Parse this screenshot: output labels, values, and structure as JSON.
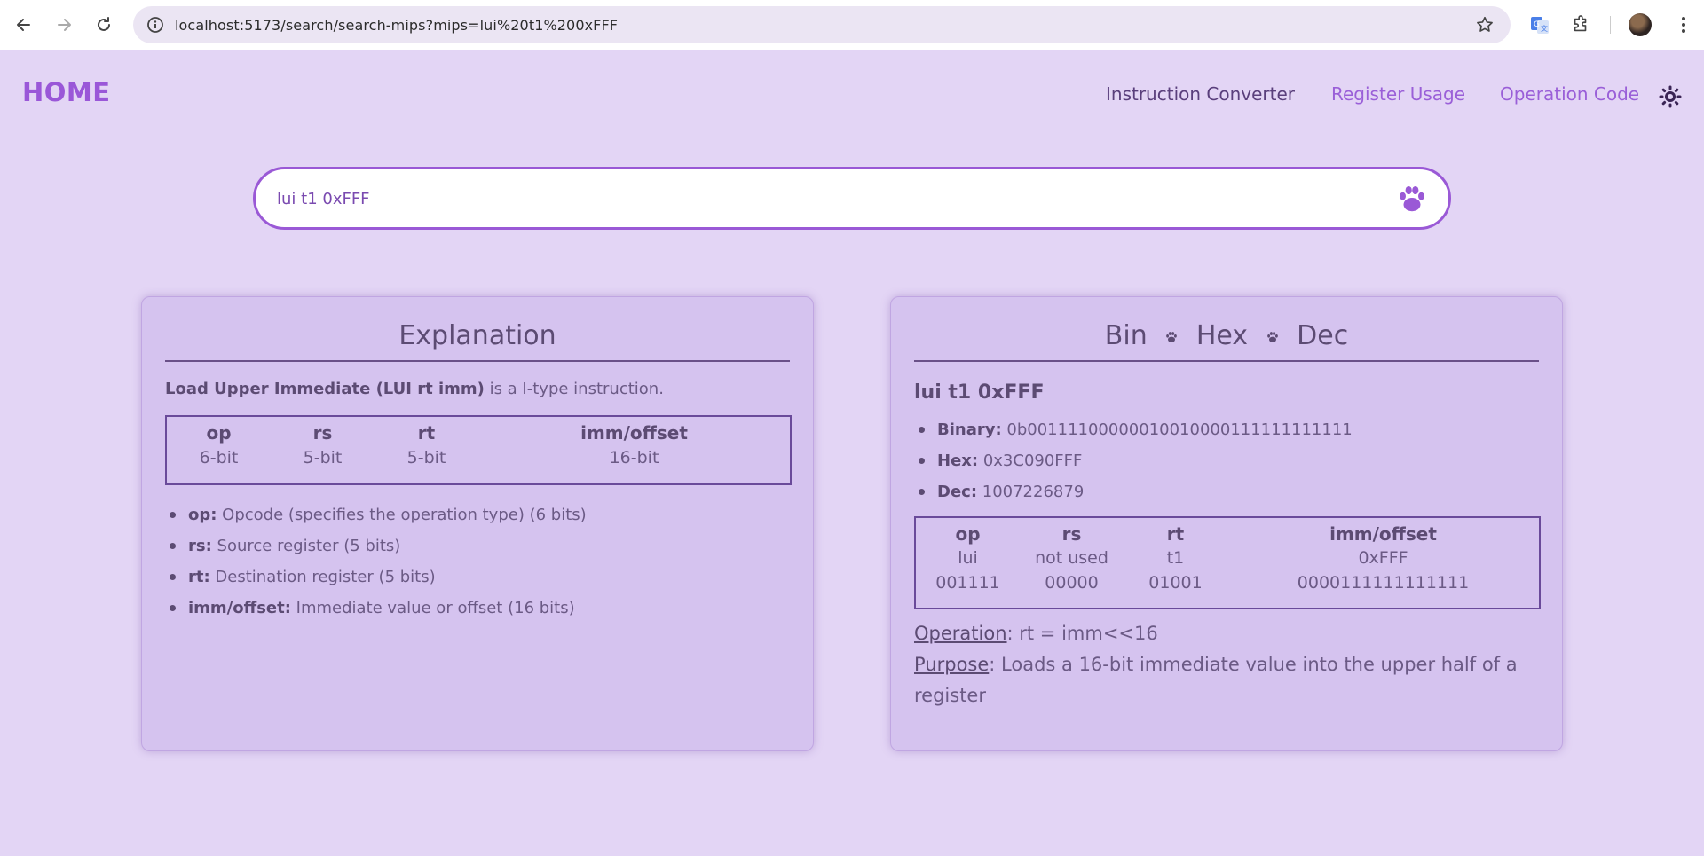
{
  "browser": {
    "url": "localhost:5173/search/search-mips?mips=lui%20t1%200xFFF"
  },
  "header": {
    "home": "HOME",
    "nav": [
      "Instruction Converter",
      "Register Usage",
      "Operation Code"
    ]
  },
  "search": {
    "value": "lui t1 0xFFF"
  },
  "explanation": {
    "title": "Explanation",
    "intro_bold": "Load Upper Immediate (LUI rt imm)",
    "intro_rest": " is a I-type instruction.",
    "table_headers": [
      "op",
      "rs",
      "rt",
      "imm/offset"
    ],
    "table_sizes": [
      "6-bit",
      "5-bit",
      "5-bit",
      "16-bit"
    ],
    "bullets": [
      {
        "term": "op:",
        "text": " Opcode (specifies the operation type) (6 bits)"
      },
      {
        "term": "rs:",
        "text": " Source register (5 bits)"
      },
      {
        "term": "rt:",
        "text": " Destination register (5 bits)"
      },
      {
        "term": "imm/offset:",
        "text": " Immediate value or offset (16 bits)"
      }
    ]
  },
  "conversion": {
    "title_parts": [
      "Bin",
      "Hex",
      "Dec"
    ],
    "instruction": "lui t1 0xFFF",
    "values": [
      {
        "term": "Binary:",
        "text": " 0b00111100000010010000111111111111"
      },
      {
        "term": "Hex:",
        "text": " 0x3C090FFF"
      },
      {
        "term": "Dec:",
        "text": " 1007226879"
      }
    ],
    "table_headers": [
      "op",
      "rs",
      "rt",
      "imm/offset"
    ],
    "table_names": [
      "lui",
      "not used",
      "t1",
      "0xFFF"
    ],
    "table_bits": [
      "001111",
      "00000",
      "01001",
      "0000111111111111"
    ],
    "operation_label": "Operation",
    "operation_text": ": rt = imm<<16",
    "purpose_label": "Purpose",
    "purpose_text": ": Loads a 16-bit immediate value into the upper half of a register"
  },
  "colors": {
    "background": "#e3d5f5",
    "card": "#d5c3ef",
    "accent": "#9a59d6",
    "text": "#5c4b73"
  },
  "icons": [
    "back-arrow-icon",
    "forward-arrow-icon",
    "reload-icon",
    "site-info-icon",
    "bookmark-star-icon",
    "translate-icon",
    "extensions-icon",
    "profile-avatar",
    "menu-kebab-icon",
    "sun-theme-icon",
    "paw-search-icon",
    "paw-separator-icon"
  ]
}
